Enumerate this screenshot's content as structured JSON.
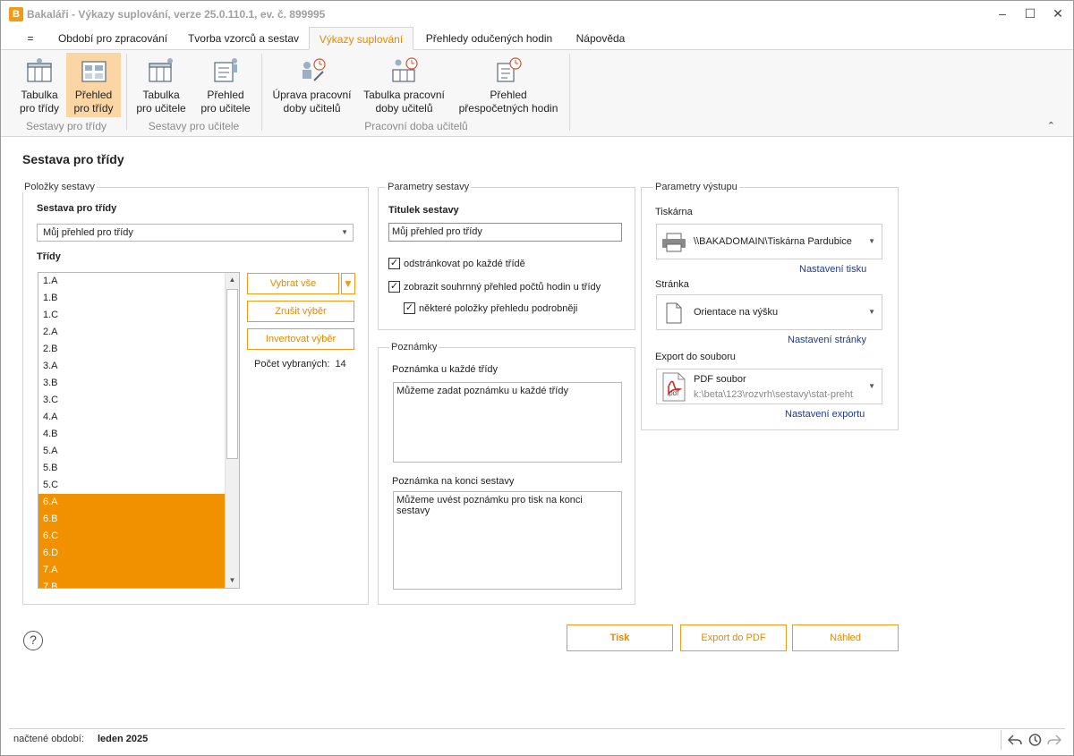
{
  "window": {
    "title": "Bakaláři - Výkazy suplování, verze 25.0.110.1, ev. č. 899995",
    "app_icon_letter": "B"
  },
  "tabs": [
    {
      "label": "="
    },
    {
      "label": "Období pro zpracování"
    },
    {
      "label": "Tvorba vzorců a sestav"
    },
    {
      "label": "Výkazy suplování"
    },
    {
      "label": "Přehledy odučených hodin"
    },
    {
      "label": "Nápověda"
    }
  ],
  "ribbon": {
    "groups": [
      {
        "label": "Sestavy pro třídy",
        "buttons": [
          {
            "line1": "Tabulka",
            "line2": "pro třídy"
          },
          {
            "line1": "Přehled",
            "line2": "pro třídy"
          }
        ]
      },
      {
        "label": "Sestavy pro učitele",
        "buttons": [
          {
            "line1": "Tabulka",
            "line2": "pro učitele"
          },
          {
            "line1": "Přehled",
            "line2": "pro učitele"
          }
        ]
      },
      {
        "label": "Pracovní doba učitelů",
        "buttons": [
          {
            "line1": "Úprava pracovní",
            "line2": "doby učitelů"
          },
          {
            "line1": "Tabulka pracovní",
            "line2": "doby učitelů"
          },
          {
            "line1": "Přehled",
            "line2": "přespočetných hodin"
          }
        ]
      }
    ]
  },
  "page": {
    "heading": "Sestava pro třídy"
  },
  "items_panel": {
    "legend": "Položky sestavy",
    "report_label": "Sestava pro třídy",
    "report_value": "Můj přehled pro třídy",
    "classes_label": "Třídy",
    "classes": [
      {
        "name": "1.A",
        "selected": false
      },
      {
        "name": "1.B",
        "selected": false
      },
      {
        "name": "1.C",
        "selected": false
      },
      {
        "name": "2.A",
        "selected": false
      },
      {
        "name": "2.B",
        "selected": false
      },
      {
        "name": "3.A",
        "selected": false
      },
      {
        "name": "3.B",
        "selected": false
      },
      {
        "name": "3.C",
        "selected": false
      },
      {
        "name": "4.A",
        "selected": false
      },
      {
        "name": "4.B",
        "selected": false
      },
      {
        "name": "5.A",
        "selected": false
      },
      {
        "name": "5.B",
        "selected": false
      },
      {
        "name": "5.C",
        "selected": false
      },
      {
        "name": "6.A",
        "selected": true
      },
      {
        "name": "6.B",
        "selected": true
      },
      {
        "name": "6.C",
        "selected": true
      },
      {
        "name": "6.D",
        "selected": true
      },
      {
        "name": "7.A",
        "selected": true
      },
      {
        "name": "7.B",
        "selected": true
      }
    ],
    "select_all": "Vybrat vše",
    "clear_selection": "Zrušit výběr",
    "invert_selection": "Invertovat výběr",
    "selected_count_label": "Počet vybraných:",
    "selected_count": "14"
  },
  "report_params": {
    "legend": "Parametry sestavy",
    "title_label": "Titulek sestavy",
    "title_value": "Můj přehled pro třídy",
    "checkboxes": [
      {
        "label": "odstránkovat po každé třídě",
        "checked": true
      },
      {
        "label": "zobrazit souhrnný přehled počtů hodin u třídy",
        "checked": true
      },
      {
        "label": "některé položky přehledu podrobněji",
        "checked": true
      }
    ]
  },
  "notes": {
    "legend": "Poznámky",
    "class_note_label": "Poznámka u každé třídy",
    "class_note_value": "Můžeme zadat poznámku u každé třídy",
    "end_note_label": "Poznámka na konci sestavy",
    "end_note_value": "Můžeme uvést poznámku pro tisk na konci sestavy"
  },
  "output_params": {
    "legend": "Parametry výstupu",
    "printer_label": "Tiskárna",
    "printer_value": "\\\\BAKADOMAIN\\Tiskárna Pardubice",
    "print_settings_link": "Nastavení tisku",
    "page_label": "Stránka",
    "page_value": "Orientace na výšku",
    "page_settings_link": "Nastavení stránky",
    "export_label": "Export do souboru",
    "export_type": "PDF soubor",
    "export_path": "k:\\beta\\123\\rozvrh\\sestavy\\stat-preht",
    "export_settings_link": "Nastavení exportu",
    "pdf_icon_text": ".pdf"
  },
  "actions": {
    "help_symbol": "?",
    "print": "Tisk",
    "export_pdf": "Export do PDF",
    "preview": "Náhled"
  },
  "status": {
    "period_label": "načtené období:",
    "period_value": "leden 2025"
  },
  "colors": {
    "accent": "#f29100",
    "active_ribbon": "#fbd5a3",
    "link": "#1f3a8a"
  }
}
